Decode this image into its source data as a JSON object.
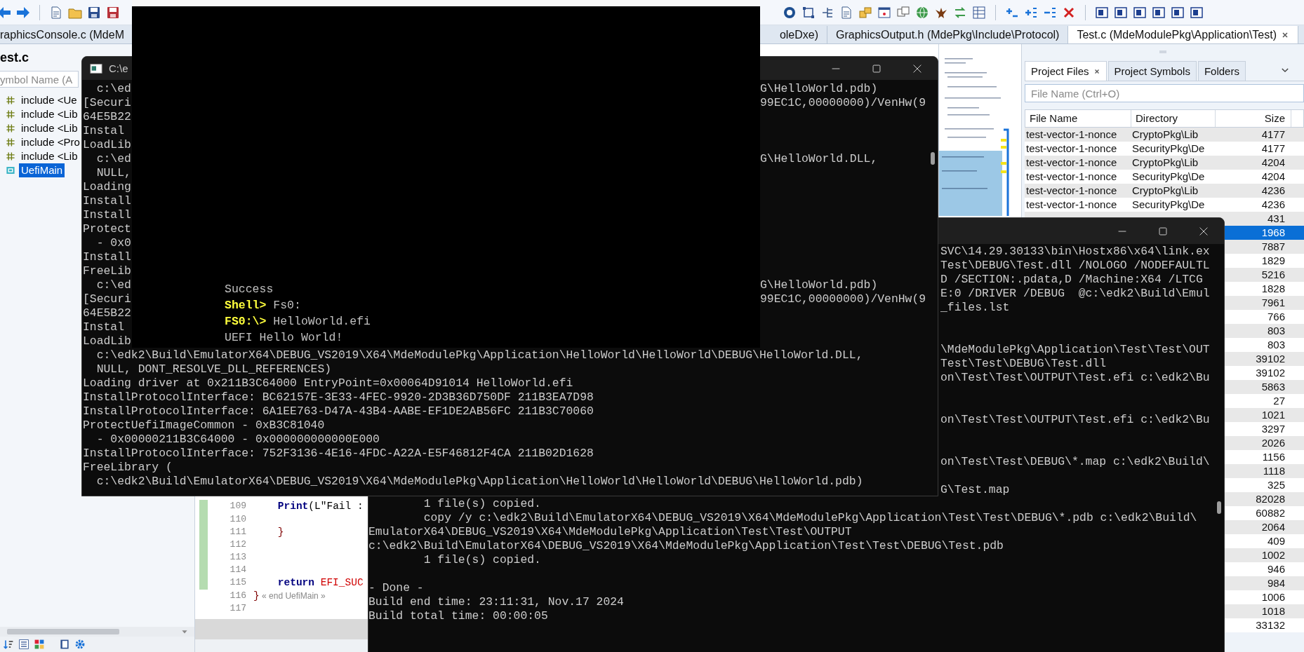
{
  "editor_tabs": [
    {
      "label": "raphicsConsole.c (MdeM",
      "selected": false
    },
    {
      "label": "oleDxe)",
      "selected": false
    },
    {
      "label": "GraphicsOutput.h (MdePkg\\Include\\Protocol)",
      "selected": false
    },
    {
      "label": "Test.c (MdeModulePkg\\Application\\Test)",
      "selected": true
    }
  ],
  "symbol_panel": {
    "file": "est.c",
    "search": {
      "placeholder": "ymbol Name (A"
    },
    "items": [
      {
        "label": "include <Ue",
        "kind": "include",
        "selected": false
      },
      {
        "label": "include <Lib",
        "kind": "include",
        "selected": false
      },
      {
        "label": "include <Lib",
        "kind": "include",
        "selected": false
      },
      {
        "label": "include <Pro",
        "kind": "include",
        "selected": false
      },
      {
        "label": "include <Lib",
        "kind": "include",
        "selected": false
      },
      {
        "label": "UefiMain",
        "kind": "function",
        "selected": true
      }
    ]
  },
  "editor": {
    "lines": [
      {
        "number": "109",
        "changed": true,
        "tokens": [
          {
            "text": "    Print",
            "kind": "function"
          },
          {
            "text": "(L\"Fail :",
            "kind": "plain"
          }
        ]
      },
      {
        "number": "110",
        "changed": true
      },
      {
        "number": "111",
        "changed": true,
        "tokens": [
          {
            "text": "    }",
            "kind": "brace"
          }
        ]
      },
      {
        "number": "112",
        "changed": true
      },
      {
        "number": "113",
        "changed": true
      },
      {
        "number": "114",
        "changed": true
      },
      {
        "number": "115",
        "changed": true,
        "tokens": [
          {
            "text": "    return",
            "kind": "keyword"
          },
          {
            "text": " EFI_SUC",
            "kind": "constant"
          }
        ]
      },
      {
        "number": "116",
        "changed": false,
        "tokens": [
          {
            "text": "}",
            "kind": "brace"
          },
          {
            "text": " « end UefiMain »",
            "kind": "annotation"
          }
        ]
      },
      {
        "number": "117",
        "changed": false
      }
    ]
  },
  "project_panel": {
    "tabs": [
      {
        "label": "Project Files",
        "selected": true,
        "closable": true
      },
      {
        "label": "Project Symbols",
        "selected": false,
        "closable": false
      },
      {
        "label": "Folders",
        "selected": false,
        "closable": false
      }
    ],
    "search": {
      "placeholder": "File Name (Ctrl+O)"
    },
    "columns": [
      "File Name",
      "Directory",
      "Size"
    ],
    "rows": [
      {
        "file_name": "test-vector-1-nonce",
        "directory": "CryptoPkg\\Lib",
        "size": "4177",
        "selected": false
      },
      {
        "file_name": "test-vector-1-nonce",
        "directory": "SecurityPkg\\De",
        "size": "4177",
        "selected": false
      },
      {
        "file_name": "test-vector-1-nonce",
        "directory": "CryptoPkg\\Lib",
        "size": "4204",
        "selected": false
      },
      {
        "file_name": "test-vector-1-nonce",
        "directory": "SecurityPkg\\De",
        "size": "4204",
        "selected": false
      },
      {
        "file_name": "test-vector-1-nonce",
        "directory": "CryptoPkg\\Lib",
        "size": "4236",
        "selected": false
      },
      {
        "file_name": "test-vector-1-nonce",
        "directory": "SecurityPkg\\De",
        "size": "4236",
        "selected": false
      },
      {
        "size": "431",
        "selected": false
      },
      {
        "size": "1968",
        "selected": true
      },
      {
        "size": "7887",
        "selected": false
      },
      {
        "size": "1829",
        "selected": false
      },
      {
        "size": "5216",
        "selected": false
      },
      {
        "size": "1828",
        "selected": false
      },
      {
        "size": "7961",
        "selected": false
      },
      {
        "size": "766",
        "selected": false
      },
      {
        "size": "803",
        "selected": false
      },
      {
        "size": "803",
        "selected": false
      },
      {
        "size": "39102",
        "selected": false
      },
      {
        "size": "39102",
        "selected": false
      },
      {
        "size": "5863",
        "selected": false
      },
      {
        "size": "27",
        "selected": false
      },
      {
        "size": "1021",
        "selected": false
      },
      {
        "size": "3297",
        "selected": false
      },
      {
        "size": "2026",
        "selected": false
      },
      {
        "size": "1156",
        "selected": false
      },
      {
        "size": "1118",
        "selected": false
      },
      {
        "size": "325",
        "selected": false
      },
      {
        "size": "82028",
        "selected": false
      },
      {
        "size": "60882",
        "selected": false
      },
      {
        "size": "2064",
        "selected": false
      },
      {
        "size": "409",
        "selected": false
      },
      {
        "size": "1002",
        "selected": false
      },
      {
        "size": "946",
        "selected": false
      },
      {
        "size": "984",
        "selected": false
      },
      {
        "size": "1006",
        "selected": false
      },
      {
        "size": "1018",
        "selected": false
      },
      {
        "size": "33132",
        "selected": false
      }
    ]
  },
  "build_console": {
    "lines": [
      {
        "kind": "clipped",
        "text": "SVC\\14.29.30133\\bin\\Hostx86\\x64\\link.ex"
      },
      {
        "kind": "clipped",
        "text": "Test\\DEBUG\\Test.dll /NOLOGO /NODEFAULTL"
      },
      {
        "kind": "clipped",
        "text": "D /SECTION:.pdata,D /Machine:X64 /LTCG"
      },
      {
        "kind": "clipped",
        "text": "E:0 /DRIVER /DEBUG  @c:\\edk2\\Build\\Emul"
      },
      {
        "kind": "clipped",
        "text": "_files.lst"
      },
      {
        "kind": "blank"
      },
      {
        "kind": "blank"
      },
      {
        "kind": "clipped",
        "text": "\\MdeModulePkg\\Application\\Test\\Test\\OUT"
      },
      {
        "kind": "clipped",
        "text": "Test\\Test\\DEBUG\\Test.dll"
      },
      {
        "kind": "clipped",
        "text": "on\\Test\\Test\\OUTPUT\\Test.efi c:\\edk2\\Bu"
      },
      {
        "kind": "blank"
      },
      {
        "kind": "blank"
      },
      {
        "kind": "clipped",
        "text": "on\\Test\\Test\\OUTPUT\\Test.efi c:\\edk2\\Bu"
      },
      {
        "kind": "blank"
      },
      {
        "kind": "blank"
      },
      {
        "kind": "clipped",
        "text": "on\\Test\\Test\\DEBUG\\*.map c:\\edk2\\Build\\"
      },
      {
        "kind": "blank"
      },
      {
        "kind": "clipped",
        "text": "G\\Test.map"
      },
      {
        "kind": "full",
        "text": "        1 file(s) copied."
      },
      {
        "kind": "full",
        "text": "        copy /y c:\\edk2\\Build\\EmulatorX64\\DEBUG_VS2019\\X64\\MdeModulePkg\\Application\\Test\\Test\\DEBUG\\*.pdb c:\\edk2\\Build\\"
      },
      {
        "kind": "full",
        "text": "EmulatorX64\\DEBUG_VS2019\\X64\\MdeModulePkg\\Application\\Test\\Test\\OUTPUT"
      },
      {
        "kind": "full",
        "text": "c:\\edk2\\Build\\EmulatorX64\\DEBUG_VS2019\\X64\\MdeModulePkg\\Application\\Test\\Test\\DEBUG\\Test.pdb"
      },
      {
        "kind": "full",
        "text": "        1 file(s) copied."
      },
      {
        "kind": "blank"
      },
      {
        "kind": "full",
        "text": "- Done -"
      },
      {
        "kind": "full",
        "text": "Build end time: 23:11:31, Nov.17 2024"
      },
      {
        "kind": "full",
        "text": "Build total time: 00:00:05"
      }
    ]
  },
  "console": {
    "title": "C:\\e",
    "lines": [
      {
        "kind": "split",
        "left": "  c:\\ed",
        "right": "G\\HelloWorld.pdb)"
      },
      {
        "kind": "split",
        "left": "[Securi",
        "right": "99EC1C,00000000)/VenHw(9"
      },
      {
        "kind": "split",
        "left": "64E5B22"
      },
      {
        "kind": "split",
        "left": "Instal"
      },
      {
        "kind": "split",
        "left": "LoadLib"
      },
      {
        "kind": "split",
        "left": "  c:\\ed",
        "right": "G\\HelloWorld.DLL,"
      },
      {
        "kind": "split",
        "left": "  NULL,"
      },
      {
        "kind": "split",
        "left": "Loading"
      },
      {
        "kind": "split",
        "left": "Install"
      },
      {
        "kind": "split",
        "left": "Install"
      },
      {
        "kind": "split",
        "left": "Protect"
      },
      {
        "kind": "split",
        "left": "  - 0x0"
      },
      {
        "kind": "split",
        "left": "Install"
      },
      {
        "kind": "split",
        "left": "FreeLib"
      },
      {
        "kind": "split",
        "left": "  c:\\ed",
        "right": "G\\HelloWorld.pdb)"
      },
      {
        "kind": "split",
        "left": "[Securi",
        "right": "99EC1C,00000000)/VenHw(9"
      },
      {
        "kind": "split",
        "left": "64E5B22"
      },
      {
        "kind": "split",
        "left": "Instal"
      },
      {
        "kind": "split",
        "left": "LoadLib"
      },
      {
        "kind": "full",
        "text": "  c:\\edk2\\Build\\EmulatorX64\\DEBUG_VS2019\\X64\\MdeModulePkg\\Application\\HelloWorld\\HelloWorld\\DEBUG\\HelloWorld.DLL,"
      },
      {
        "kind": "full",
        "text": "  NULL, DONT_RESOLVE_DLL_REFERENCES)"
      },
      {
        "kind": "full",
        "text": "Loading driver at 0x211B3C64000 EntryPoint=0x00064D91014 HelloWorld.efi"
      },
      {
        "kind": "full",
        "text": "InstallProtocolInterface: BC62157E-3E33-4FEC-9920-2D3B36D750DF 211B3EA7D98"
      },
      {
        "kind": "full",
        "text": "InstallProtocolInterface: 6A1EE763-D47A-43B4-AABE-EF1DE2AB56FC 211B3C70060"
      },
      {
        "kind": "full",
        "text": "ProtectUefiImageCommon - 0xB3C81040"
      },
      {
        "kind": "full",
        "text": "  - 0x00000211B3C64000 - 0x000000000000E000"
      },
      {
        "kind": "full",
        "text": "InstallProtocolInterface: 752F3136-4E16-4FDC-A22A-E5F46812F4CA 211B02D1628"
      },
      {
        "kind": "full",
        "text": "FreeLibrary ("
      },
      {
        "kind": "full",
        "text": "  c:\\edk2\\Build\\EmulatorX64\\DEBUG_VS2019\\X64\\MdeModulePkg\\Application\\HelloWorld\\HelloWorld\\DEBUG\\HelloWorld.pdb)"
      }
    ]
  },
  "uefi_shell": {
    "lines": [
      {
        "text": "Success"
      },
      {
        "prompt": "Shell>",
        "text": "Fs0:"
      },
      {
        "prompt": "FS0:\\>",
        "text": "HelloWorld.efi"
      },
      {
        "text": "UEFI Hello World!"
      }
    ]
  }
}
